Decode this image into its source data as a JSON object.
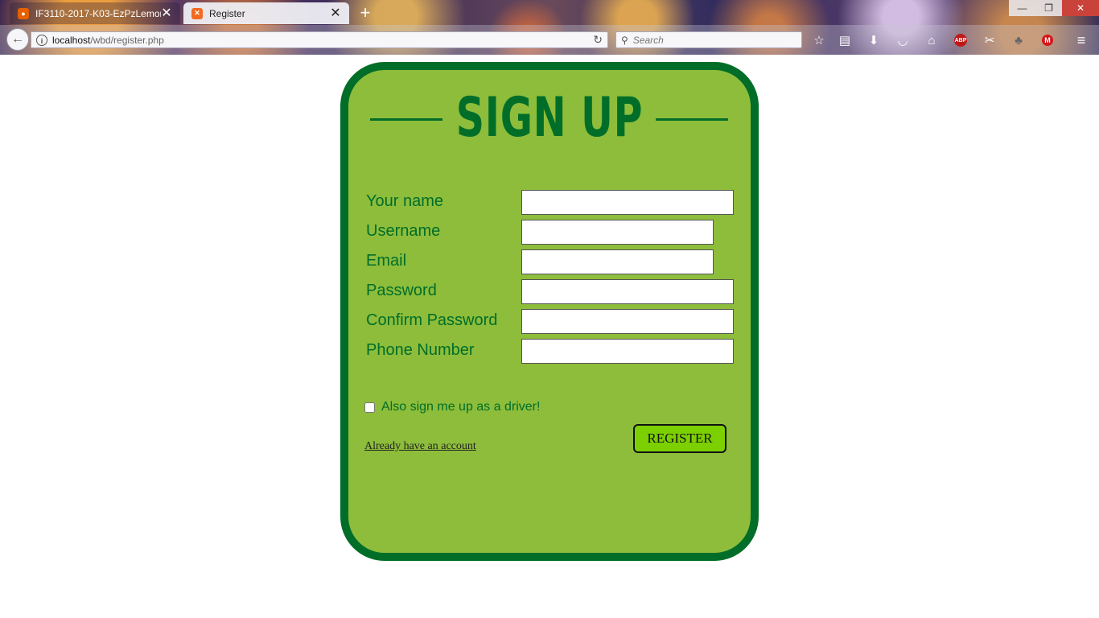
{
  "browser": {
    "tabs": [
      {
        "title": "IF3110-2017-K03-EzPzLemon",
        "active": false
      },
      {
        "title": "Register",
        "active": true
      }
    ],
    "new_tab_icon": "plus-icon",
    "url": {
      "host": "localhost",
      "path": "/wbd/register.php"
    },
    "search_placeholder": "Search",
    "toolbar_icons": [
      "star-icon",
      "reading-list-icon",
      "download-icon",
      "pocket-icon",
      "home-icon",
      "adblock-icon",
      "screenshot-icon",
      "extension-icon",
      "mega-icon",
      "menu-icon"
    ],
    "adblock_label": "ABP",
    "mega_label": "M"
  },
  "page": {
    "title": "SIGN UP",
    "fields": [
      {
        "label": "Your name",
        "value": ""
      },
      {
        "label": "Username",
        "value": ""
      },
      {
        "label": "Email",
        "value": ""
      },
      {
        "label": "Password",
        "value": ""
      },
      {
        "label": "Confirm Password",
        "value": ""
      },
      {
        "label": "Phone Number",
        "value": ""
      }
    ],
    "driver_checkbox_label": "Also sign me up as a driver!",
    "driver_checked": false,
    "login_link": "Already have an account",
    "register_button": "REGISTER",
    "colors": {
      "card": "#8dbd3b",
      "border": "#006e28",
      "button": "#7cd000"
    }
  }
}
